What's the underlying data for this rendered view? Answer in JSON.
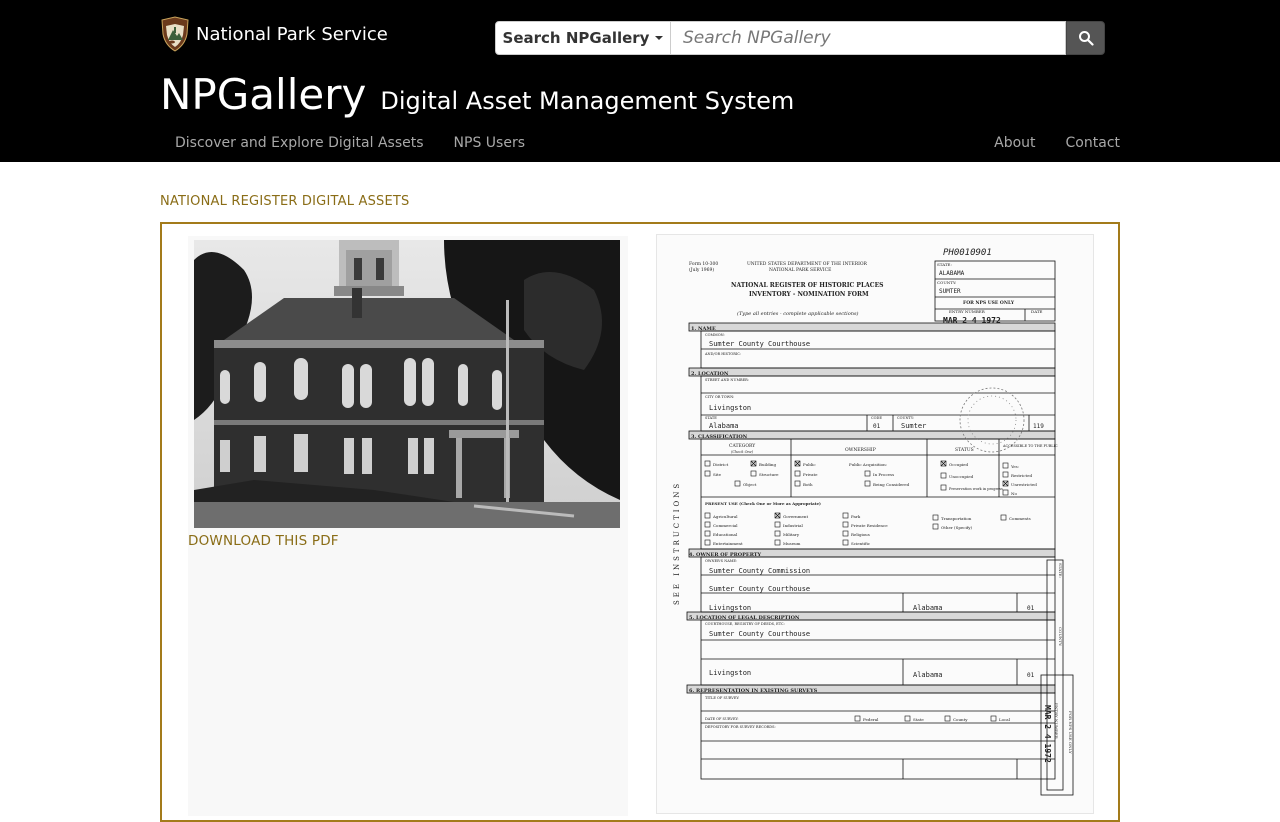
{
  "header": {
    "brand_name": "National Park Service",
    "search": {
      "dropdown_label": "Search NPGallery",
      "placeholder": "Search NPGallery"
    },
    "site_name": "NPGallery",
    "site_subtitle": "Digital Asset Management System",
    "nav_left": [
      {
        "label": "Discover and Explore Digital Assets"
      },
      {
        "label": "NPS Users"
      }
    ],
    "nav_right": [
      {
        "label": "About"
      },
      {
        "label": "Contact"
      }
    ]
  },
  "main": {
    "section_title": "NATIONAL REGISTER DIGITAL ASSETS",
    "download_label": "DOWNLOAD THIS PDF",
    "document": {
      "id_handwritten": "PH0010901",
      "form_number": "Form 10-300",
      "form_date": "(July 1969)",
      "agency_line1": "UNITED STATES DEPARTMENT OF THE INTERIOR",
      "agency_line2": "NATIONAL PARK SERVICE",
      "form_title1": "NATIONAL REGISTER OF HISTORIC PLACES",
      "form_title2": "INVENTORY - NOMINATION FORM",
      "form_instr": "(Type all entries - complete applicable sections)",
      "state_label": "STATE:",
      "state_value": "ALABAMA",
      "county_label": "COUNTY:",
      "county_value": "SUMTER",
      "nps_use": "FOR NPS USE ONLY",
      "entry_label": "ENTRY NUMBER",
      "date_label": "DATE",
      "entry_stamp": "MAR 2 4 1972",
      "sec1": "1. NAME",
      "common_label": "COMMON:",
      "common_value": "Sumter County Courthouse",
      "historic_label": "AND/OR HISTORIC:",
      "sec2": "2. LOCATION",
      "street_label": "STREET AND NUMBER:",
      "city_label": "CITY OR TOWN:",
      "city_value": "Livingston",
      "loc_state_label": "STATE",
      "loc_state_value": "Alabama",
      "code_label": "CODE",
      "state_code": "01",
      "county_lbl": "COUNTY:",
      "loc_county_value": "Sumter",
      "county_code": "119",
      "sec3": "3. CLASSIFICATION",
      "cat_header": "CATEGORY",
      "cat_sub": "(Check One)",
      "own_header": "OWNERSHIP",
      "status_header": "STATUS",
      "access_header": "ACCESSIBLE TO THE PUBLIC",
      "cat_items": [
        "District",
        "Building",
        "Site",
        "Structure",
        "Object"
      ],
      "own_items": [
        "Public",
        "Private",
        "Both"
      ],
      "acq_label": "Public Acquisition:",
      "acq_items": [
        "In Process",
        "Being Considered"
      ],
      "status_items": [
        "Occupied",
        "Unoccupied",
        "Preservation work in progress"
      ],
      "access_items": [
        "Yes:",
        "Restricted",
        "Unrestricted",
        "No"
      ],
      "present_use_label": "PRESENT USE (Check One or More as Appropriate)",
      "use_col1": [
        "Agricultural",
        "Commercial",
        "Educational",
        "Entertainment"
      ],
      "use_col2": [
        "Government",
        "Industrial",
        "Military",
        "Museum"
      ],
      "use_col3": [
        "Park",
        "Private Residence",
        "Religious",
        "Scientific"
      ],
      "use_col4": [
        "Transportation",
        "Other (Specify)"
      ],
      "use_col5": [
        "Comments"
      ],
      "sec4": "4. OWNER OF PROPERTY",
      "owner_name_label": "OWNER'S NAME:",
      "owner_name_value": "Sumter County Commission",
      "owner_street_value": "Sumter County Courthouse",
      "owner_city_value": "Livingston",
      "owner_state_value": "Alabama",
      "owner_code": "01",
      "sec5": "5. LOCATION OF LEGAL DESCRIPTION",
      "courthouse_label": "COURTHOUSE, REGISTRY OF DEEDS, ETC:",
      "courthouse_value": "Sumter County Courthouse",
      "legal_city_value": "Livingston",
      "legal_state_value": "Alabama",
      "legal_code": "01",
      "sec6": "6. REPRESENTATION IN EXISTING SURVEYS",
      "survey_title_label": "TITLE OF SURVEY:",
      "survey_date_label": "DATE OF SURVEY:",
      "survey_opts": [
        "Federal",
        "State",
        "County",
        "Local"
      ],
      "depository_label": "DEPOSITORY FOR SURVEY RECORDS:",
      "side_text": "SEE INSTRUCTIONS",
      "right_strip1": "STATE:",
      "right_strip2": "COUNTY:",
      "right_strip3": "FOR NPS USE ONLY",
      "right_strip4": "ENTRY NUMBER",
      "right_stamp": "MAR 2 4 1972"
    }
  }
}
